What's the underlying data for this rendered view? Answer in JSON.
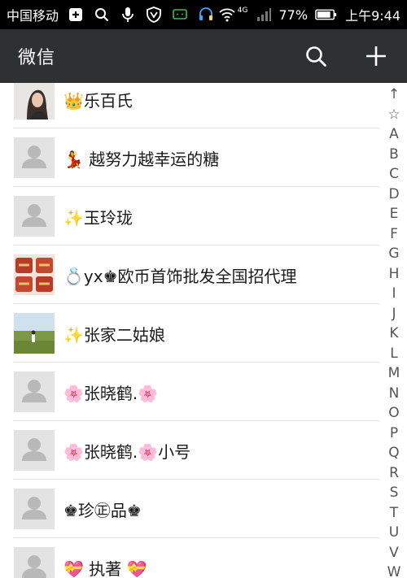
{
  "status_bar": {
    "carrier": "中国移动",
    "network": "4G",
    "battery": "77%",
    "time": "上午9:44"
  },
  "header": {
    "title": "微信"
  },
  "contacts": [
    {
      "name": "👑乐百氏",
      "avatar": "photo-woman"
    },
    {
      "name": "💃 越努力越幸运的糖",
      "avatar": "default"
    },
    {
      "name": "✨玉玲珑",
      "avatar": "default"
    },
    {
      "name": "💍yx♚欧币首饰批发全国招代理",
      "avatar": "photo-jewelry"
    },
    {
      "name": "✨张家二姑娘",
      "avatar": "photo-field"
    },
    {
      "name": "🌸张晓鹤.🌸",
      "avatar": "default"
    },
    {
      "name": "🌸张晓鹤.🌸小号",
      "avatar": "default"
    },
    {
      "name": "♚珍㊣品♚",
      "avatar": "default"
    },
    {
      "name": "💝    执著    💝",
      "avatar": "default"
    }
  ],
  "index_bar": [
    "↑",
    "☆",
    "A",
    "B",
    "C",
    "D",
    "E",
    "F",
    "G",
    "H",
    "I",
    "J",
    "K",
    "L",
    "M",
    "N",
    "O",
    "P",
    "Q",
    "R",
    "S",
    "T",
    "U",
    "V",
    "W"
  ]
}
